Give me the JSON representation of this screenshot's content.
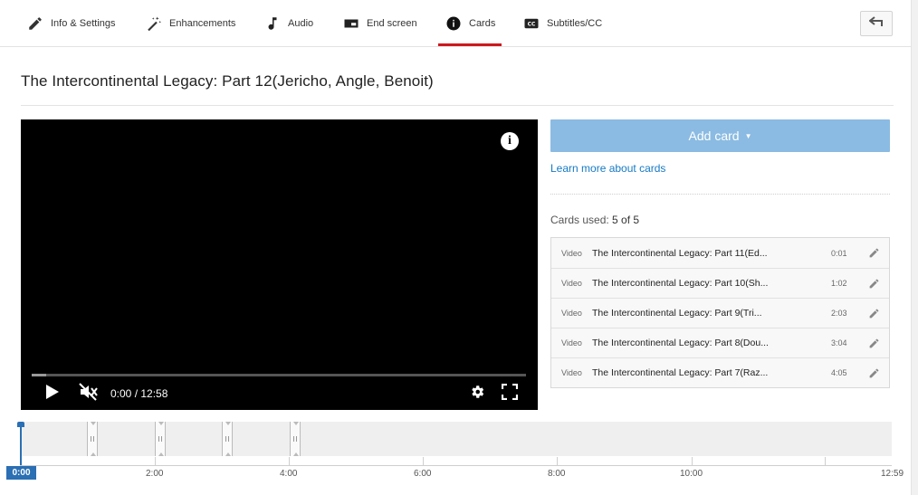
{
  "tabs": [
    {
      "label": "Info & Settings",
      "icon": "pencil-icon"
    },
    {
      "label": "Enhancements",
      "icon": "magic-wand-icon"
    },
    {
      "label": "Audio",
      "icon": "music-note-icon"
    },
    {
      "label": "End screen",
      "icon": "end-screen-icon"
    },
    {
      "label": "Cards",
      "icon": "info-icon",
      "active": true
    },
    {
      "label": "Subtitles/CC",
      "icon": "closed-captions-icon"
    }
  ],
  "back_icon": "back-arrow-icon",
  "video_title": "The Intercontinental Legacy: Part 12(Jericho, Angle, Benoit)",
  "player": {
    "time_display": "0:00 / 12:58",
    "muted": true,
    "progress_loaded_fraction": 0.03
  },
  "panel": {
    "add_card_label": "Add card",
    "learn_more": "Learn more about cards",
    "cards_used_label": "Cards used:",
    "cards_used_count": "5 of 5",
    "cards": [
      {
        "type": "Video",
        "title": "The Intercontinental Legacy: Part 11(Ed...",
        "time": "0:01"
      },
      {
        "type": "Video",
        "title": "The Intercontinental Legacy: Part 10(Sh...",
        "time": "1:02"
      },
      {
        "type": "Video",
        "title": "The Intercontinental Legacy: Part 9(Tri...",
        "time": "2:03"
      },
      {
        "type": "Video",
        "title": "The Intercontinental Legacy: Part 8(Dou...",
        "time": "3:04"
      },
      {
        "type": "Video",
        "title": "The Intercontinental Legacy: Part 7(Raz...",
        "time": "4:05"
      }
    ]
  },
  "timeline": {
    "current_time": "0:00",
    "tick_labels": [
      "2:00",
      "4:00",
      "6:00",
      "8:00",
      "10:00",
      "12:59"
    ],
    "accent_color": "#2b6fb4"
  },
  "colors": {
    "active_tab_underline": "#cc181e",
    "add_card_button": "#8bbbe2",
    "link": "#167ac6"
  }
}
